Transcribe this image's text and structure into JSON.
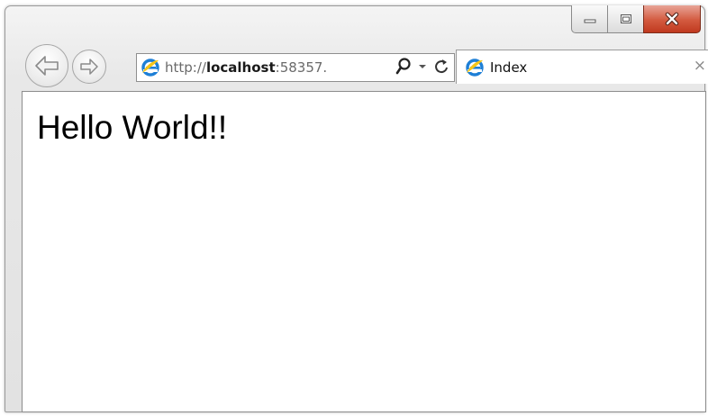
{
  "window": {
    "caption_buttons": [
      "minimize-icon",
      "maximize-icon",
      "close-icon"
    ],
    "close_color": "#c8432a"
  },
  "nav": {
    "back_icon": "back-arrow-icon",
    "forward_icon": "forward-arrow-icon"
  },
  "address_bar": {
    "url_prefix": "http://",
    "url_host": "localhost",
    "url_suffix": ":58357.",
    "search_icon": "search-icon",
    "dropdown_icon": "chevron-down-icon",
    "refresh_icon": "refresh-icon"
  },
  "tab": {
    "title": "Index",
    "close_label": "×",
    "icon": "ie-icon"
  },
  "page": {
    "heading": "Hello World!!"
  },
  "colors": {
    "ie_blue": "#1e7fd6",
    "ie_ring": "#f5c518"
  }
}
